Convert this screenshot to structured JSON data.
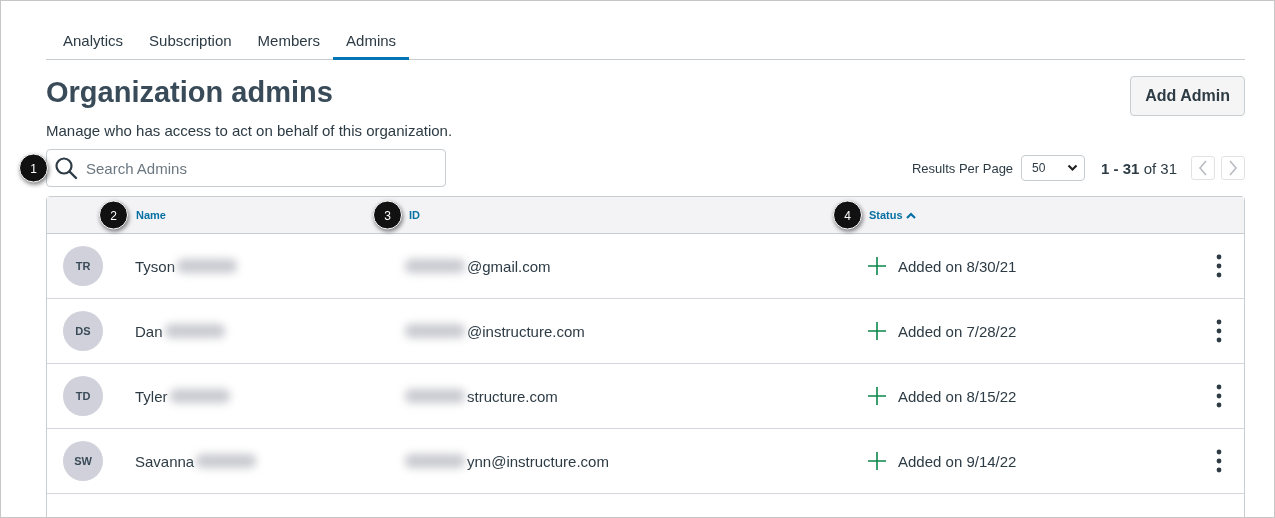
{
  "tabs": [
    {
      "label": "Analytics",
      "selected": false
    },
    {
      "label": "Subscription",
      "selected": false
    },
    {
      "label": "Members",
      "selected": false
    },
    {
      "label": "Admins",
      "selected": true
    }
  ],
  "page": {
    "title": "Organization admins",
    "subtitle": "Manage who has access to act on behalf of this organization.",
    "add_button": "Add Admin"
  },
  "search": {
    "placeholder": "Search Admins",
    "callout": "1"
  },
  "pagination": {
    "label": "Results Per Page",
    "per_page": "50",
    "range": "1 - 31",
    "of": "of 31"
  },
  "table": {
    "columns": [
      {
        "label": "Name",
        "callout": "2",
        "sorted": false
      },
      {
        "label": "ID",
        "callout": "3",
        "sorted": false
      },
      {
        "label": "Status",
        "callout": "4",
        "sorted": true
      }
    ],
    "rows": [
      {
        "initials": "TR",
        "name": "Tyson",
        "id": "@gmail.com",
        "status": "Added on 8/30/21"
      },
      {
        "initials": "DS",
        "name": "Dan",
        "id": "@instructure.com",
        "status": "Added on 7/28/22"
      },
      {
        "initials": "TD",
        "name": "Tyler",
        "id": "structure.com",
        "status": "Added on 8/15/22"
      },
      {
        "initials": "SW",
        "name": "Savanna",
        "id": "ynn@instructure.com",
        "status": "Added on 9/14/22"
      }
    ]
  }
}
